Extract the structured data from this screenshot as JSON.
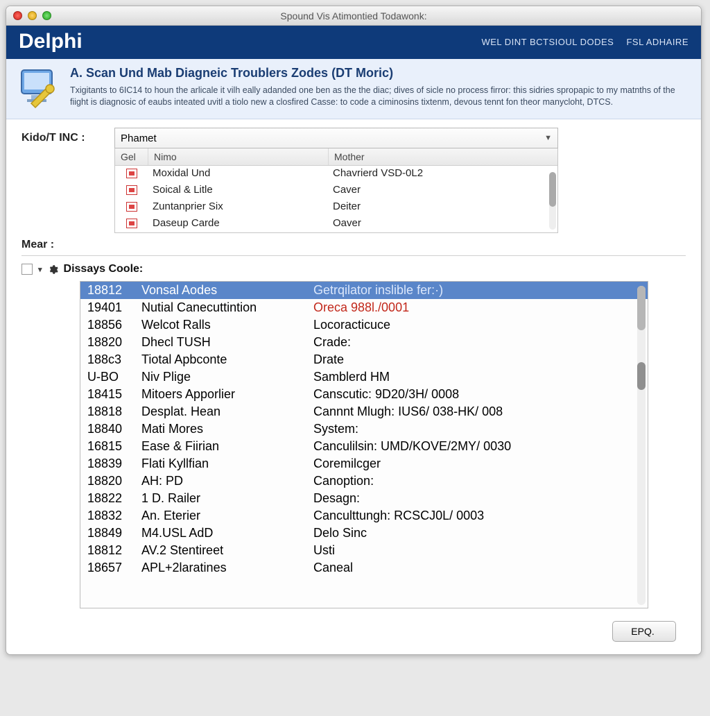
{
  "window": {
    "title": "Spound Vis Atimontied Todawonk:"
  },
  "brand": {
    "name": "Delphi",
    "right1": "WEL DINT BCTSIOUL DODES",
    "right2": "FSL ADHAIRE"
  },
  "info": {
    "heading": "A. Scan Und Mab Diagneic Troublers Zodes (DT Moric)",
    "body": "Txigitants to 6IC14 to houn the arlicale it vilh eally adanded one ben as the the diac; dives of sicle no process firror: this sidries spropapic to my matnths of the fiight is diagnosic of eaubs inteated uvitl a tiolo new a closfired Casse: to code a ciminosins tixtenm, devous tennt fon theor manycloht, DTCS."
  },
  "topform": {
    "label1": "Kido/T INC :",
    "select_value": "Phamet",
    "label2": "Mear :",
    "cols": {
      "c0": "Gel",
      "c1": "Nimo",
      "c2": "Mother"
    },
    "rows": [
      {
        "c1": "Moxidal Und",
        "c2": "Chavrierd VSD-0L2"
      },
      {
        "c1": "Soical & Litle",
        "c2": "Caver"
      },
      {
        "c1": "Zuntanprier Six",
        "c2": "Deiter"
      },
      {
        "c1": "Daseup Carde",
        "c2": "Oaver"
      }
    ]
  },
  "mid": {
    "label": "Dissays Coole:"
  },
  "codes": [
    {
      "c0": "18812",
      "c1": "Vonsal Aodes",
      "c2": "Getrqilator inslible fer:·)"
    },
    {
      "c0": "19401",
      "c1": "Nutial Canecuttintion",
      "c2": "Oreca 988l./0001",
      "red": true
    },
    {
      "c0": "18856",
      "c1": "Welcot Ralls",
      "c2": "Locoracticuce"
    },
    {
      "c0": "18820",
      "c1": "Dhecl TUSH",
      "c2": "Crade:"
    },
    {
      "c0": "188c3",
      "c1": "Tiotal Apbconte",
      "c2": "Drate"
    },
    {
      "c0": "U-BO",
      "c1": "Niv Plige",
      "c2": "Samblerd HM"
    },
    {
      "c0": "18415",
      "c1": "Mitoers Apporlier",
      "c2": "Canscutic: 9D20/3H/ 0008"
    },
    {
      "c0": "18818",
      "c1": "Desplat. Hean",
      "c2": "Cannnt Mlugh: IUS6/ 038-HK/ 008"
    },
    {
      "c0": "18840",
      "c1": "Mati Mores",
      "c2": "System:"
    },
    {
      "c0": "16815",
      "c1": "Ease & Fiirian",
      "c2": "Canculilsin: UMD/KOVE/2MY/ 0030"
    },
    {
      "c0": "18839",
      "c1": "Flati Kyllfian",
      "c2": "Coremilcger"
    },
    {
      "c0": "18820",
      "c1": "AH: PD",
      "c2": "Canoption:"
    },
    {
      "c0": "18822",
      "c1": "1 D. Railer",
      "c2": "Desagn:"
    },
    {
      "c0": "18832",
      "c1": "An. Eterier",
      "c2": "Canculttungh: RCSCJ0L/ 0003"
    },
    {
      "c0": "18849",
      "c1": "M4.USL AdD",
      "c2": "Delo Sinc"
    },
    {
      "c0": "18812",
      "c1": "AV.2 Stentireet",
      "c2": "Usti"
    },
    {
      "c0": "18657",
      "c1": "APL+2laratines",
      "c2": "Caneal"
    }
  ],
  "footer": {
    "button": "EPQ."
  }
}
